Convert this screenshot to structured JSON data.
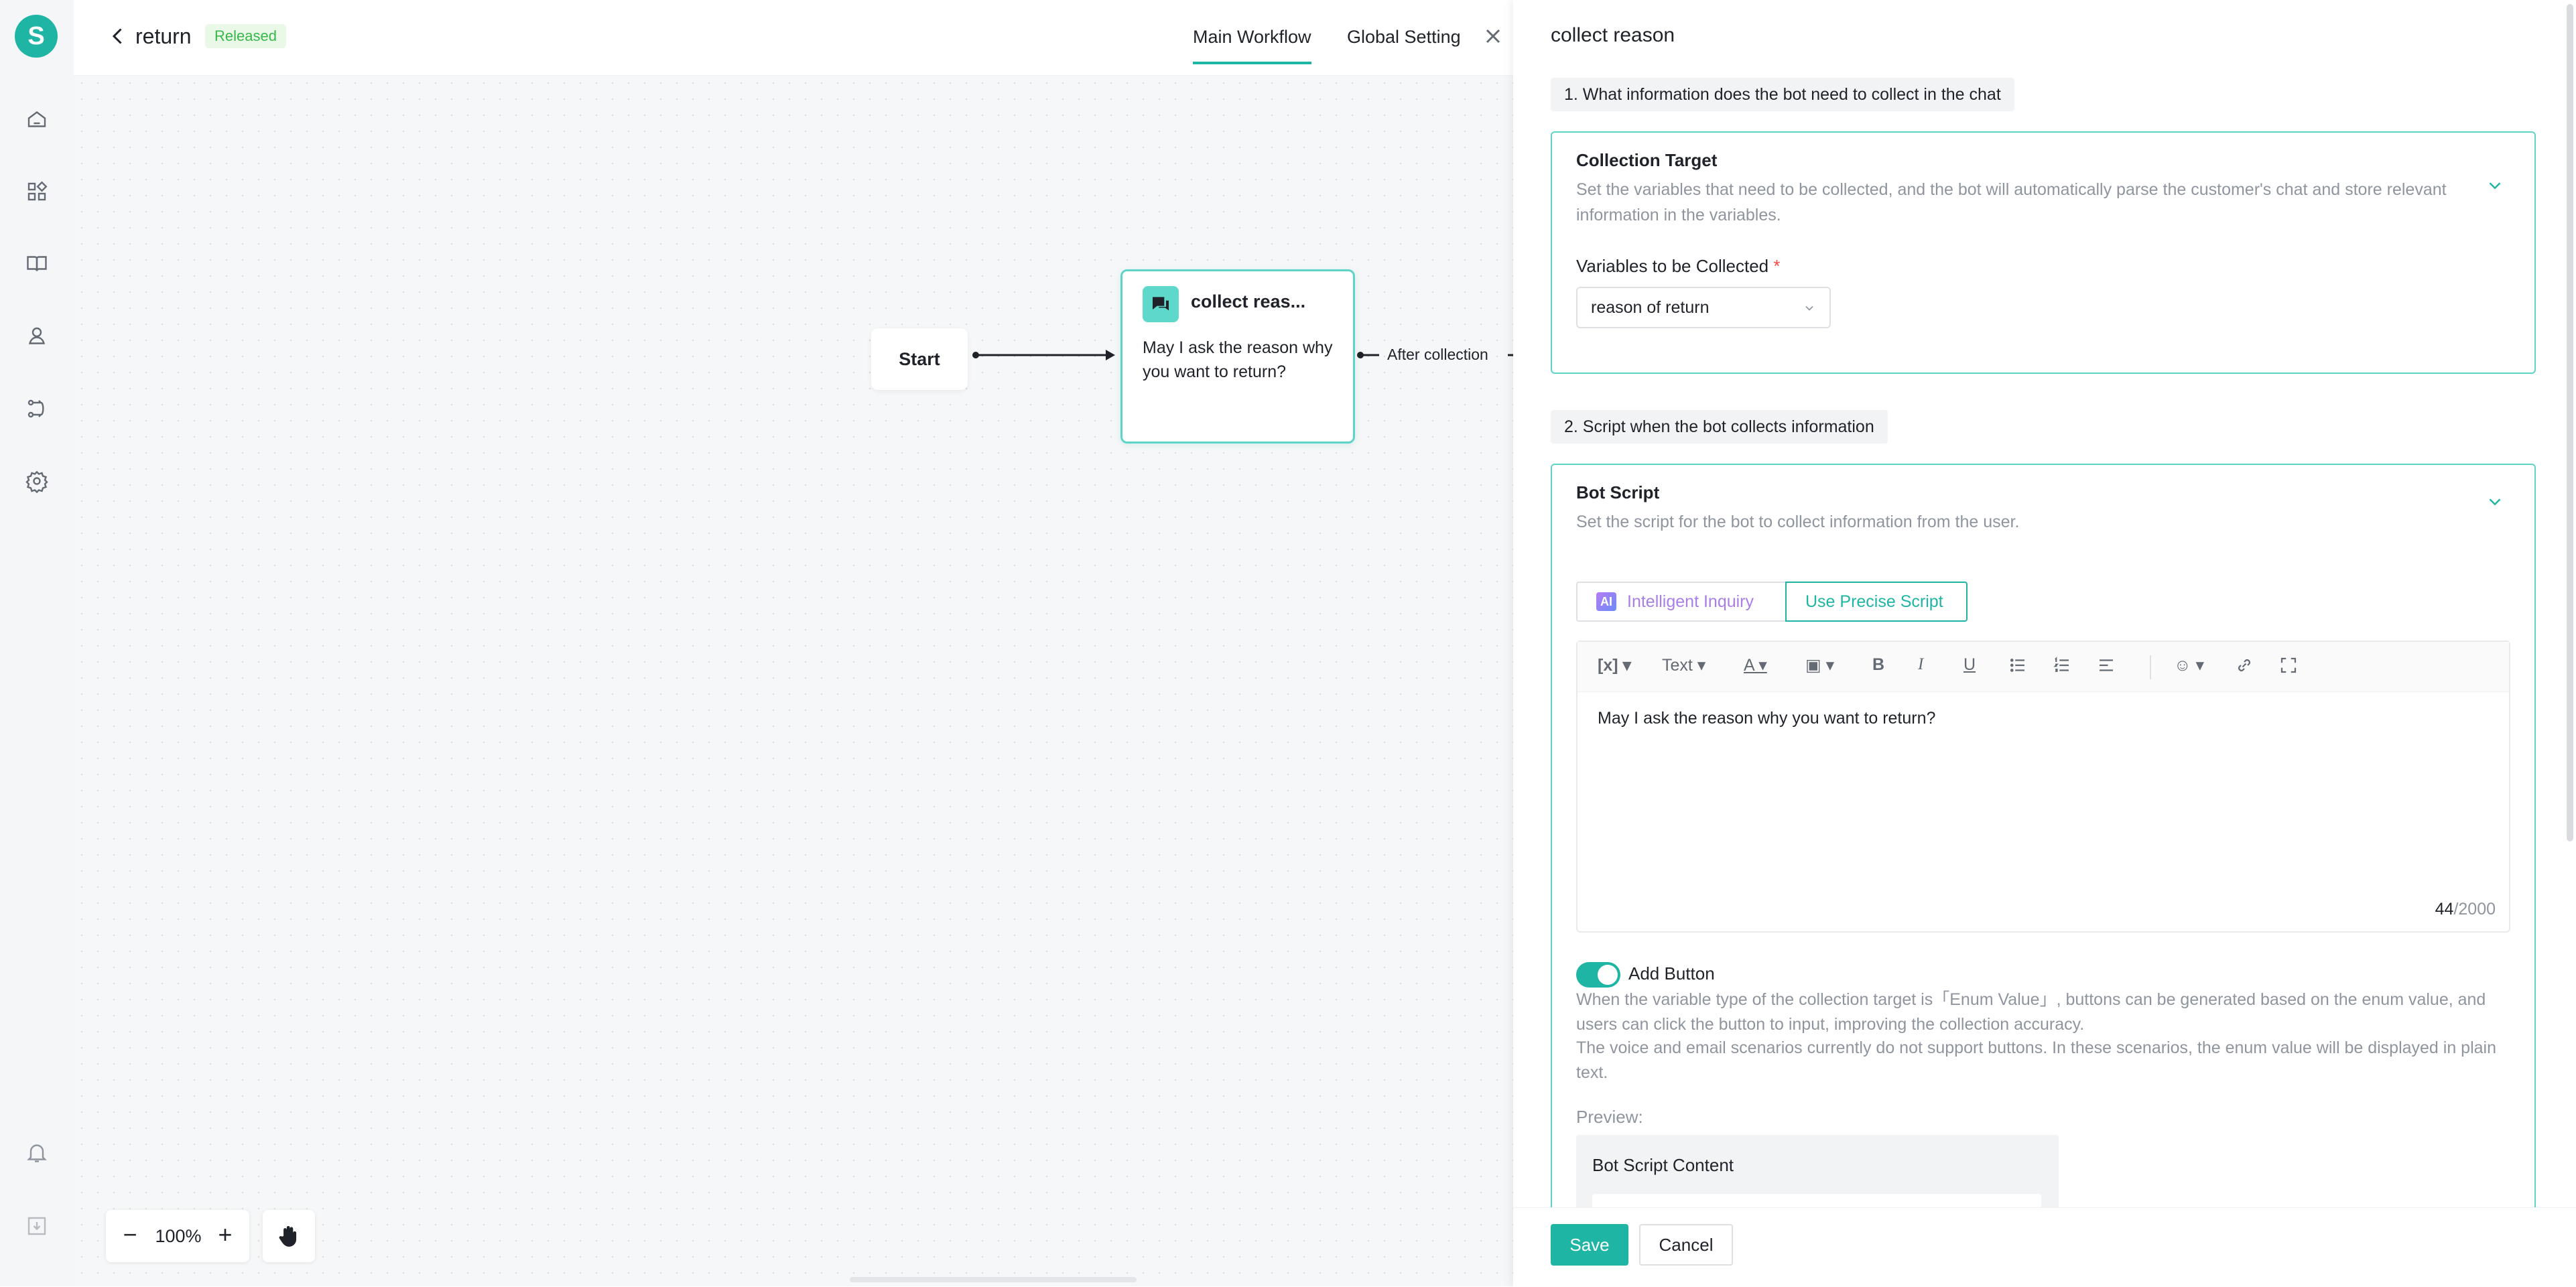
{
  "app": {
    "logo_letter": "S"
  },
  "rail": {
    "icons": [
      "home-icon",
      "apps-icon",
      "book-icon",
      "bot-icon",
      "workflow-icon",
      "settings-icon",
      "bell-icon",
      "download-icon"
    ]
  },
  "header": {
    "title": "return",
    "status": "Released",
    "tabs": [
      {
        "label": "Main Workflow",
        "active": true
      },
      {
        "label": "Global Setting",
        "active": false
      }
    ]
  },
  "canvas": {
    "start_label": "Start",
    "collect_node": {
      "title": "collect reas...",
      "body": "May I ask the reason why you want to return?"
    },
    "edge_label": "After collection",
    "zoom": "100%"
  },
  "panel": {
    "title": "collect reason",
    "section1": "1. What information does the bot need to collect in the chat",
    "collection_target": {
      "title": "Collection Target",
      "desc": "Set the variables that need to be collected, and the bot will automatically parse the customer's chat and store relevant information in the variables.",
      "vars_label": "Variables to be Collected",
      "required_mark": "*",
      "selected": "reason of return"
    },
    "section2": "2. Script when the bot collects information",
    "bot_script": {
      "title": "Bot Script",
      "desc": "Set the script for the bot to collect information from the user.",
      "mode_ai_badge": "AI",
      "mode_ai": "Intelligent Inquiry",
      "mode_precise": "Use Precise Script",
      "toolbar_text": "Text",
      "content": "May I ask the reason why you want to return?",
      "count": "44",
      "max": "/2000",
      "add_button_label": "Add Button",
      "add_button_on": true,
      "note1": "When the variable type of the collection target is「Enum Value」, buttons can be generated based on the enum value, and users can click the button to input, improving the collection accuracy.",
      "note2": "The voice and email scenarios currently do not support buttons. In these scenarios, the enum value will be displayed in plain text.",
      "preview_label": "Preview:",
      "preview_title": "Bot Script Content"
    },
    "save": "Save",
    "cancel": "Cancel"
  },
  "colors": {
    "accent": "#1fb5a4",
    "node_border": "#5fd3c8",
    "released": "#36b84a",
    "ai": "#a97ee8"
  }
}
